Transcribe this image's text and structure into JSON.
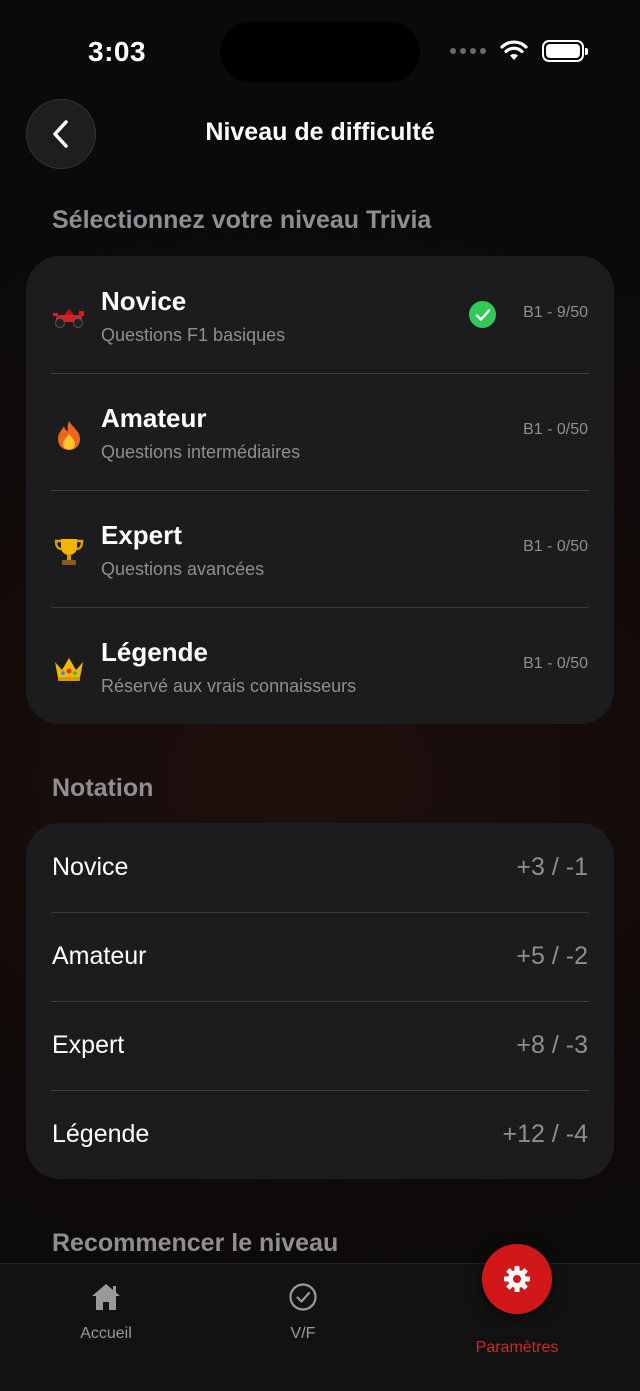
{
  "status": {
    "time": "3:03"
  },
  "header": {
    "title": "Niveau de difficulté"
  },
  "levels_section": {
    "title": "Sélectionnez votre niveau Trivia",
    "items": [
      {
        "name": "Novice",
        "description": "Questions F1 basiques",
        "progress": "B1 - 9/50",
        "icon": "race-car-icon",
        "selected": true
      },
      {
        "name": "Amateur",
        "description": "Questions intermédiaires",
        "progress": "B1 - 0/50",
        "icon": "fire-icon",
        "selected": false
      },
      {
        "name": "Expert",
        "description": "Questions avancées",
        "progress": "B1 - 0/50",
        "icon": "trophy-icon",
        "selected": false
      },
      {
        "name": "Légende",
        "description": "Réservé aux vrais connaisseurs",
        "progress": "B1 - 0/50",
        "icon": "crown-icon",
        "selected": false
      }
    ]
  },
  "scoring_section": {
    "title": "Notation",
    "items": [
      {
        "name": "Novice",
        "value": "+3 / -1"
      },
      {
        "name": "Amateur",
        "value": "+5 / -2"
      },
      {
        "name": "Expert",
        "value": "+8 / -3"
      },
      {
        "name": "Légende",
        "value": "+12 / -4"
      }
    ]
  },
  "reset_section": {
    "title": "Recommencer le niveau"
  },
  "tabbar": {
    "home_label": "Accueil",
    "truefalse_label": "V/F",
    "settings_label": "Paramètres",
    "active_color": "#d01818"
  },
  "colors": {
    "selected_check": "#34c759"
  }
}
